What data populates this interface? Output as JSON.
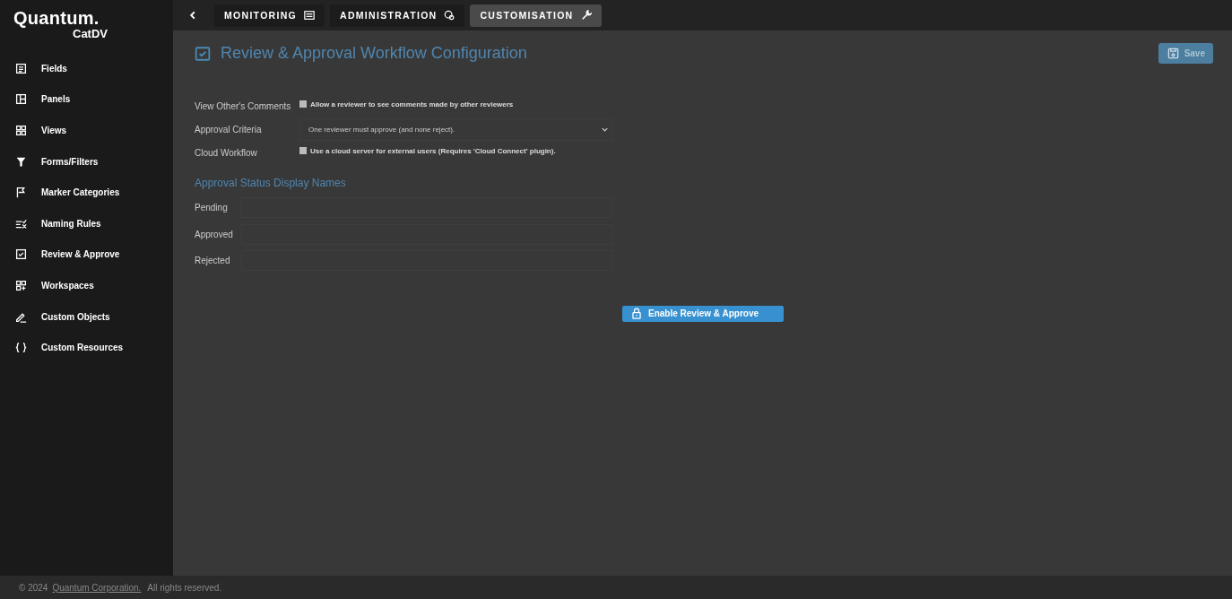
{
  "logo": {
    "brand": "Quantum.",
    "product": "CatDV"
  },
  "sidebar": {
    "items": [
      {
        "label": "Fields",
        "selected": false
      },
      {
        "label": "Panels",
        "selected": false
      },
      {
        "label": "Views",
        "selected": false
      },
      {
        "label": "Forms/Filters",
        "selected": false
      },
      {
        "label": "Marker Categories",
        "selected": false
      },
      {
        "label": "Naming Rules",
        "selected": false
      },
      {
        "label": "Review & Approve",
        "selected": false
      },
      {
        "label": "Workspaces",
        "selected": false
      },
      {
        "label": "Custom Objects",
        "selected": false
      },
      {
        "label": "Custom Resources",
        "selected": false
      }
    ]
  },
  "tabs": [
    {
      "label": "MONITORING",
      "selected": false
    },
    {
      "label": "ADMINISTRATION",
      "selected": false
    },
    {
      "label": "CUSTOMISATION",
      "selected": true
    }
  ],
  "page": {
    "title": "Review & Approval Workflow Configuration",
    "save": {
      "label": "Save",
      "disabled": true
    }
  },
  "settings": [
    {
      "kind": "checkbox",
      "label": "View Other's Comments",
      "text": "Allow a reviewer to see comments made by other reviewers",
      "checked": false
    },
    {
      "kind": "select",
      "label": "Approval Criteria",
      "value": "One reviewer must approve (and none reject)."
    },
    {
      "kind": "checkbox",
      "label": "Cloud Workflow",
      "text": "Use a cloud server for external users (Requires 'Cloud Connect' plugin).",
      "checked": false
    }
  ],
  "status_names": {
    "heading": "Approval Status Display Names",
    "fields": [
      {
        "label": "Pending"
      },
      {
        "label": "Approved"
      },
      {
        "label": "Rejected"
      }
    ]
  },
  "enable_button": {
    "label": "Enable Review & Approve"
  },
  "footer": {
    "copyright": "© 2024",
    "link": "Quantum Corporation.",
    "rights": "All rights reserved."
  }
}
